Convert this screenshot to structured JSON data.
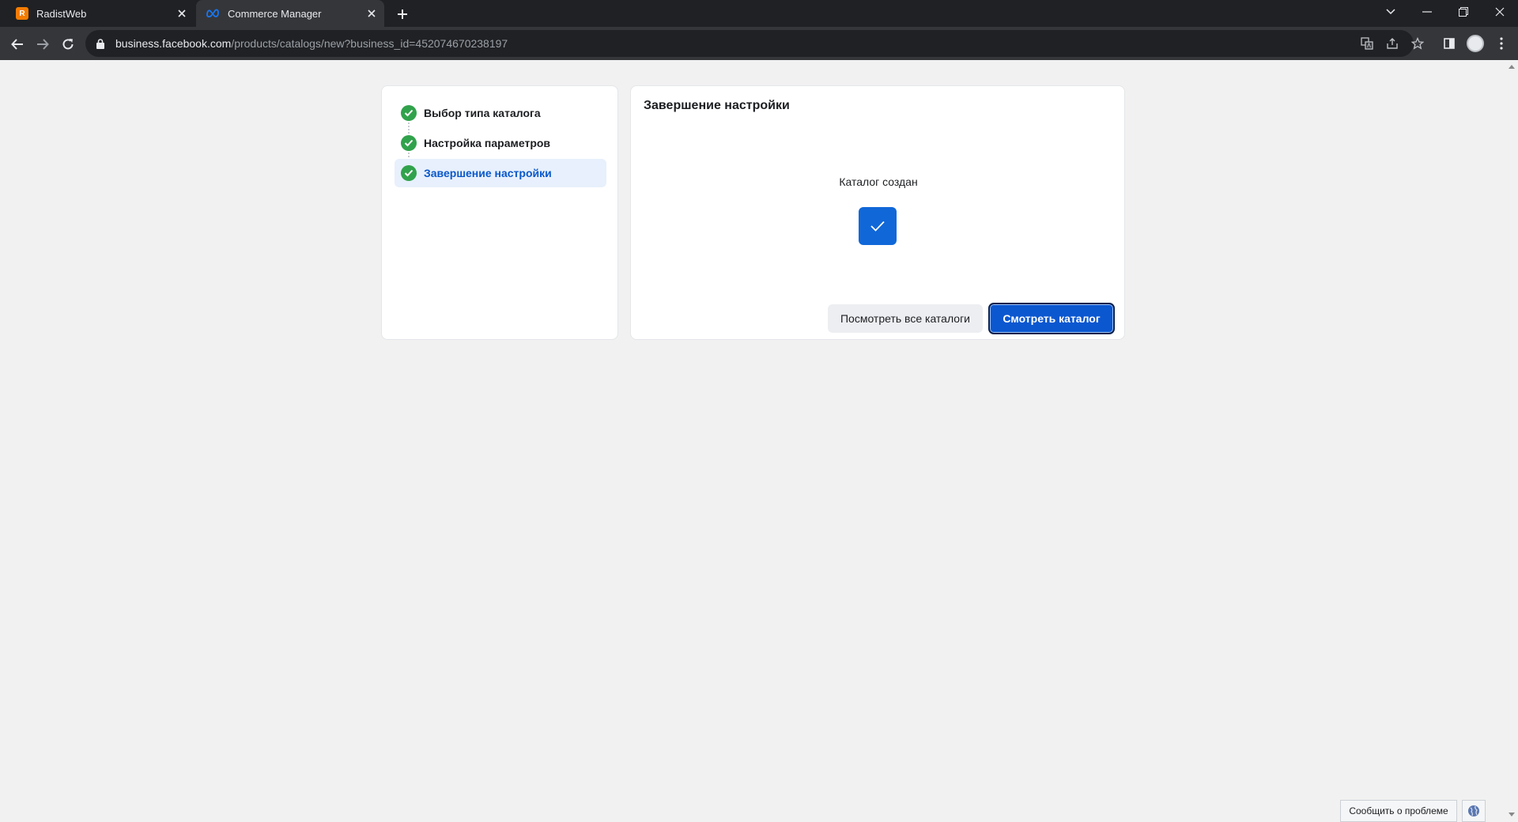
{
  "browser": {
    "tabs": [
      {
        "title": "RadistWeb",
        "favicon": "radistweb-favicon"
      },
      {
        "title": "Commerce Manager",
        "favicon": "meta-favicon"
      }
    ],
    "url_host": "business.facebook.com",
    "url_path": "/products/catalogs/new?business_id=452074670238197"
  },
  "steps": {
    "items": [
      {
        "label": "Выбор типа каталога",
        "status": "done"
      },
      {
        "label": "Настройка параметров",
        "status": "done"
      },
      {
        "label": "Завершение настройки",
        "status": "done",
        "active": true
      }
    ]
  },
  "main": {
    "title": "Завершение настройки",
    "message": "Каталог создан",
    "secondary_button": "Посмотреть все каталоги",
    "primary_button": "Смотреть каталог"
  },
  "footer": {
    "report_button": "Сообщить о проблеме"
  },
  "colors": {
    "accent": "#0b57d0",
    "success": "#31a24c",
    "active_step_bg": "#e7f0fc"
  }
}
